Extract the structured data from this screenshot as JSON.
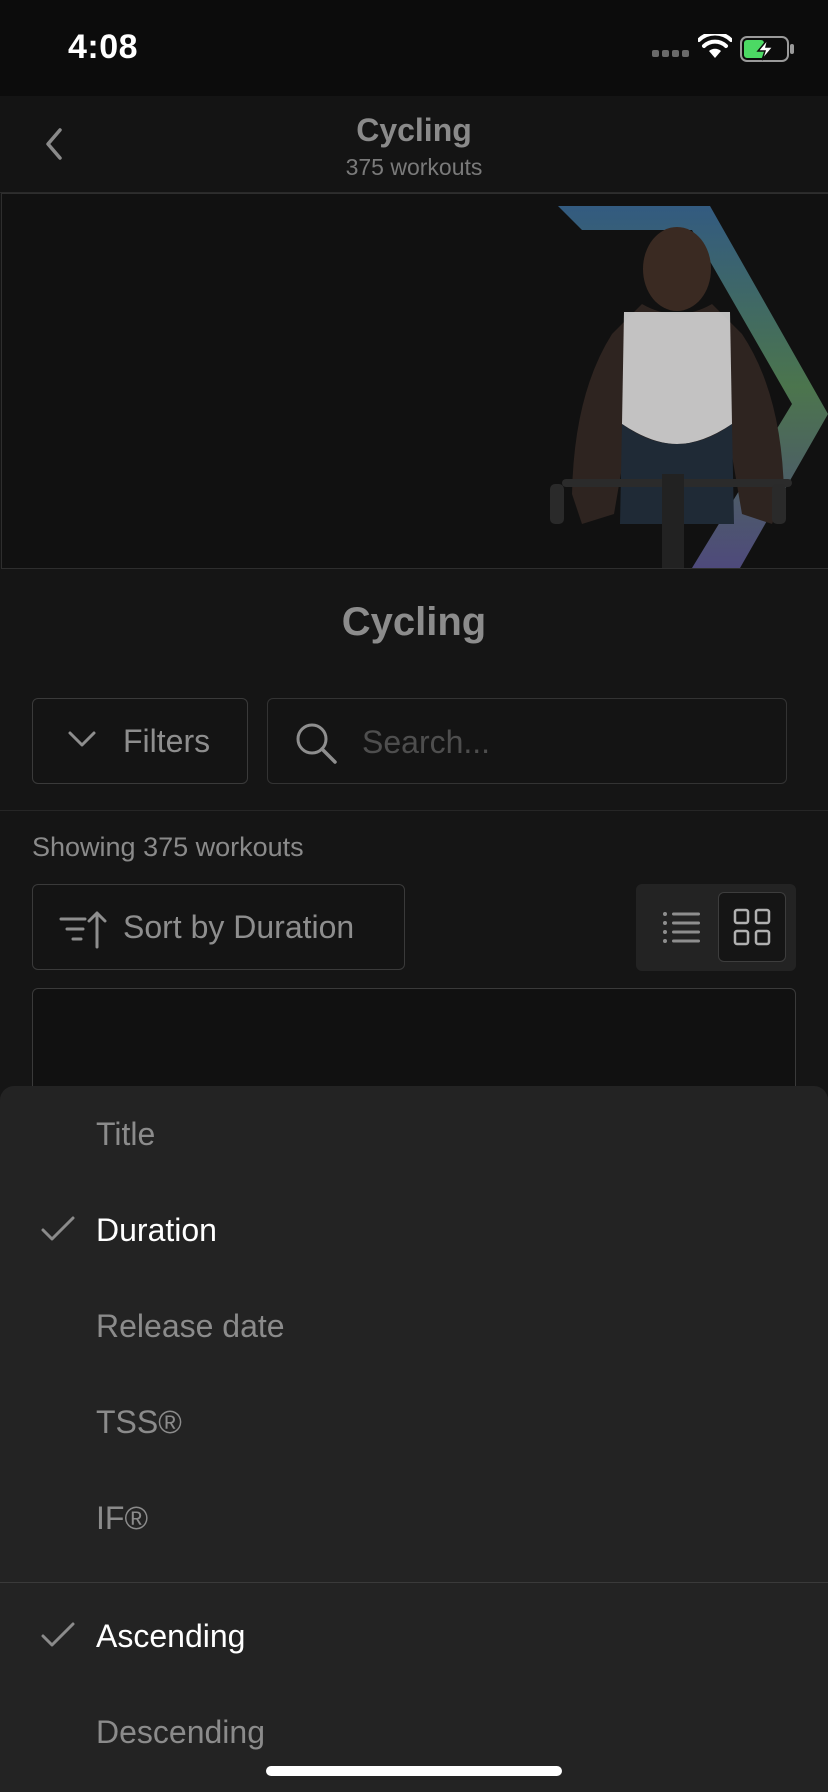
{
  "status_bar": {
    "time": "4:08",
    "icons": [
      "signal-icon",
      "wifi-icon",
      "battery-charging-icon"
    ]
  },
  "nav": {
    "back_icon": "chevron-left-icon",
    "title": "Cycling",
    "subtitle": "375 workouts"
  },
  "hero": {
    "image": "cyclist-photo",
    "accent_colors": [
      "#3b82c4",
      "#6fae4f",
      "#7a6cc0"
    ]
  },
  "section_title": "Cycling",
  "filters": {
    "label": "Filters",
    "icon": "chevron-down-icon"
  },
  "search": {
    "placeholder": "Search...",
    "value": "",
    "icon": "search-icon"
  },
  "results": {
    "showing_text": "Showing 375 workouts"
  },
  "sort": {
    "label": "Sort by Duration",
    "icon": "sort-ascending-icon"
  },
  "view_toggle": {
    "options": [
      "list-view",
      "grid-view"
    ],
    "selected": "grid-view"
  },
  "sort_sheet": {
    "sort_fields": [
      {
        "label": "Title",
        "selected": false
      },
      {
        "label": "Duration",
        "selected": true
      },
      {
        "label": "Release date",
        "selected": false
      },
      {
        "label": "TSS®",
        "selected": false
      },
      {
        "label": "IF®",
        "selected": false
      }
    ],
    "sort_orders": [
      {
        "label": "Ascending",
        "selected": true
      },
      {
        "label": "Descending",
        "selected": false
      }
    ],
    "check_icon": "checkmark-icon"
  },
  "colors": {
    "background": "#151515",
    "sheet": "#232323",
    "text_selected": "#ffffff",
    "text_muted": "#8b8b8b"
  }
}
